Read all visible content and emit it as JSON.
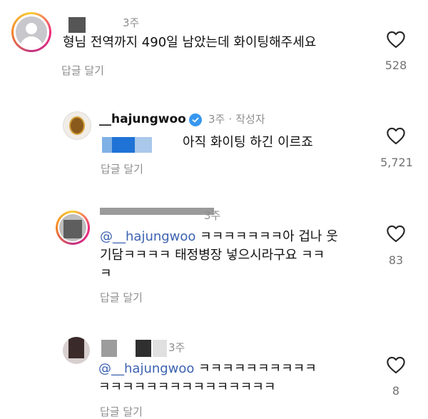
{
  "comments": [
    {
      "time": "3주",
      "text": "형님 전역까지 490일 남았는데 화이팅해주세요",
      "reply": "답글 달기",
      "likes": "528"
    },
    {
      "username": "__hajungwoo",
      "time": "3주",
      "author_badge": "작성자",
      "separator": "·",
      "text": "아직 화이팅 하긴 이르죠",
      "reply": "답글 달기",
      "likes": "5,721"
    },
    {
      "time": "3주",
      "mention": "@__hajungwoo",
      "text_line1": " ㅋㅋㅋㅋㅋㅋㅋ아 겁나 웃",
      "text_line2": "기담ㅋㅋㅋㅋ 태정병장 넣으시라구요 ㅋㅋ",
      "text_line3": "ㅋ",
      "reply": "답글 달기",
      "likes": "83"
    },
    {
      "time": "3주",
      "mention": "@__hajungwoo",
      "text_line1": " ㅋㅋㅋㅋㅋㅋㅋㅋㅋㅋ",
      "text_line2": "ㅋㅋㅋㅋㅋㅋㅋㅋㅋㅋㅋㅋㅋㅋㅋ",
      "reply": "답글 달기",
      "likes": "8"
    }
  ],
  "icons": {
    "like": "heart-outline-icon",
    "verified": "verified-badge-icon",
    "avatar_default": "default-avatar-icon"
  },
  "colors": {
    "mention": "#3c62b0",
    "meta": "#8e8e8e",
    "verified": "#3897f0"
  }
}
